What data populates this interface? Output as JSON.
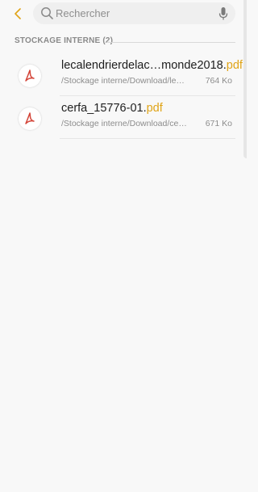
{
  "search": {
    "placeholder": "Rechercher"
  },
  "section": {
    "title": "STOCKAGE INTERNE (2)"
  },
  "files": [
    {
      "name": "lecalendrierdelac…monde2018.",
      "ext": "pdf",
      "path": "/Stockage interne/Download/le…",
      "size": "764 Ko",
      "icon": "pdf-icon"
    },
    {
      "name": "cerfa_15776-01.",
      "ext": "pdf",
      "path": "/Stockage interne/Download/ce…",
      "size": "671 Ko",
      "icon": "pdf-icon"
    }
  ],
  "colors": {
    "accent": "#e0a417",
    "pdf_red": "#d4463a",
    "background": "#f8f8f8"
  }
}
